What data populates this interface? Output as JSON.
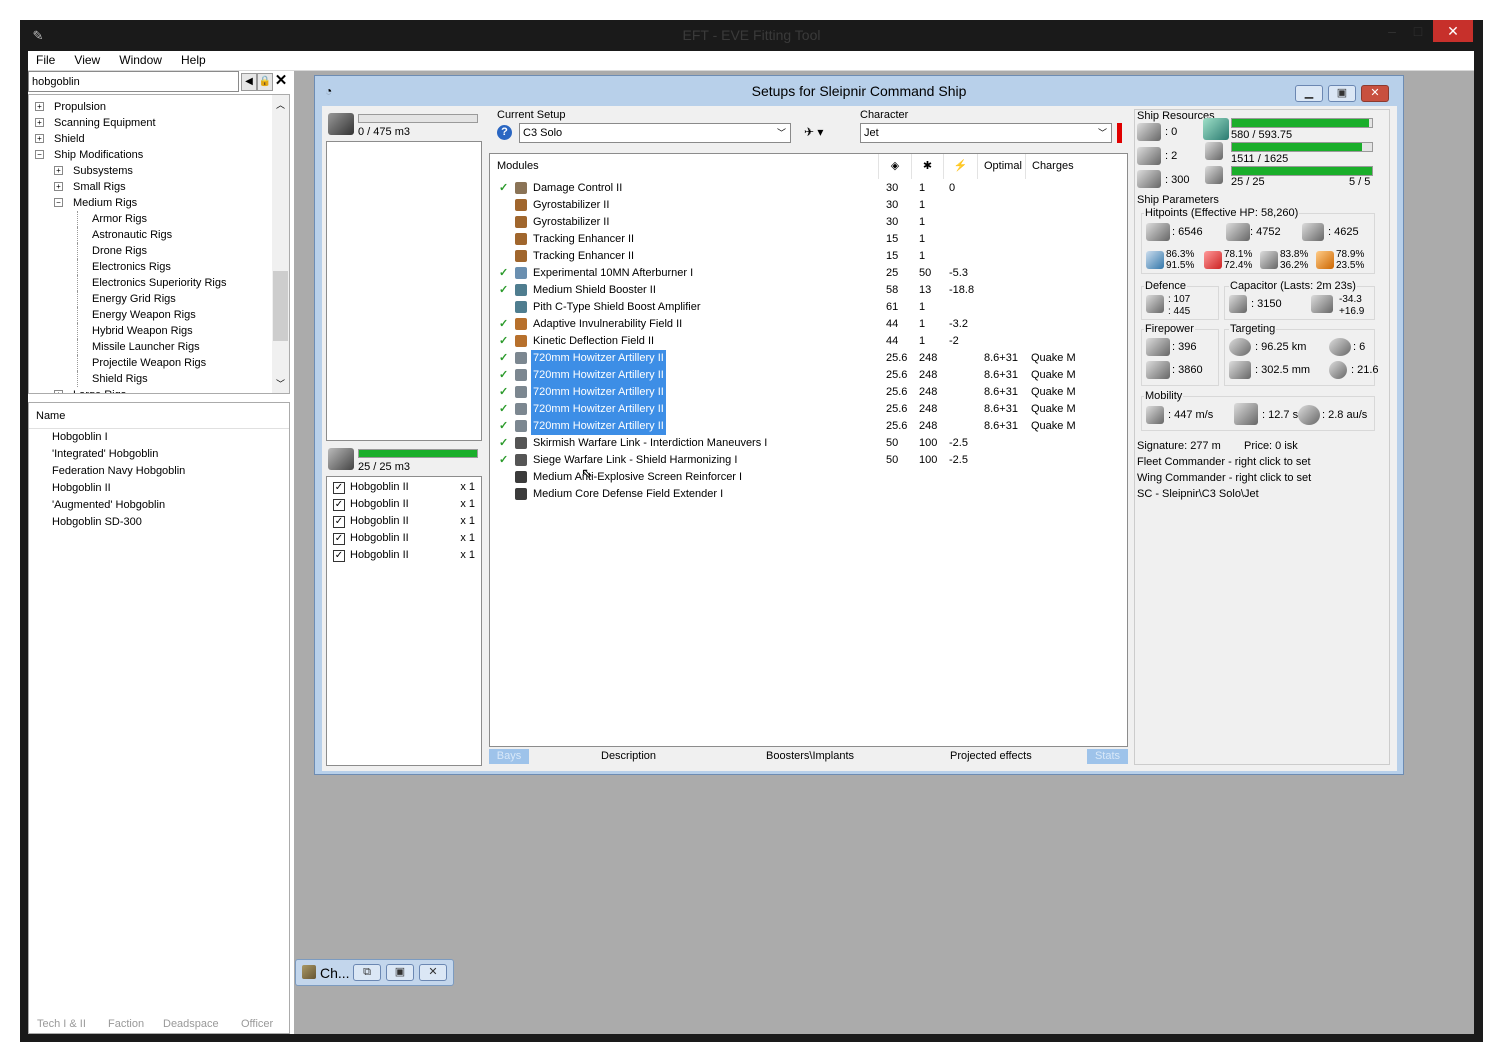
{
  "window": {
    "title": "EFT - EVE Fitting Tool",
    "app_icon": "eft-logo-icon"
  },
  "menu": [
    "File",
    "View",
    "Window",
    "Help"
  ],
  "search": {
    "value": "hobgoblin"
  },
  "tree": [
    {
      "label": "Propulsion",
      "indent": 0,
      "box": "+"
    },
    {
      "label": "Scanning Equipment",
      "indent": 0,
      "box": "+"
    },
    {
      "label": "Shield",
      "indent": 0,
      "box": "+"
    },
    {
      "label": "Ship Modifications",
      "indent": 0,
      "box": "−"
    },
    {
      "label": "Subsystems",
      "indent": 1,
      "box": "+"
    },
    {
      "label": "Small Rigs",
      "indent": 1,
      "box": "+"
    },
    {
      "label": "Medium Rigs",
      "indent": 1,
      "box": "−"
    },
    {
      "label": "Armor Rigs",
      "indent": 2
    },
    {
      "label": "Astronautic Rigs",
      "indent": 2
    },
    {
      "label": "Drone Rigs",
      "indent": 2
    },
    {
      "label": "Electronics Rigs",
      "indent": 2
    },
    {
      "label": "Electronics Superiority Rigs",
      "indent": 2
    },
    {
      "label": "Energy Grid Rigs",
      "indent": 2
    },
    {
      "label": "Energy Weapon Rigs",
      "indent": 2
    },
    {
      "label": "Hybrid Weapon Rigs",
      "indent": 2
    },
    {
      "label": "Missile Launcher Rigs",
      "indent": 2
    },
    {
      "label": "Projectile Weapon Rigs",
      "indent": 2
    },
    {
      "label": "Shield Rigs",
      "indent": 2
    },
    {
      "label": "Large Rigs",
      "indent": 1,
      "box": "+"
    }
  ],
  "names": {
    "header": "Name",
    "items": [
      "Hobgoblin I",
      "'Integrated' Hobgoblin",
      "Federation Navy Hobgoblin",
      "Hobgoblin II",
      "'Augmented' Hobgoblin",
      "Hobgoblin SD-300"
    ]
  },
  "bottom_tabs": [
    "Tech I & II",
    "Faction",
    "Deadspace",
    "Officer"
  ],
  "child_min": {
    "label": "Ch..."
  },
  "fit": {
    "title": "Setups for Sleipnir Command Ship",
    "cargo": {
      "text": "0 / 475 m3",
      "fill": 0
    },
    "drone_bay": {
      "text": "25 / 25 m3",
      "fill": 1.0
    },
    "drones": [
      {
        "name": "Hobgoblin II",
        "qty": "x 1"
      },
      {
        "name": "Hobgoblin II",
        "qty": "x 1"
      },
      {
        "name": "Hobgoblin II",
        "qty": "x 1"
      },
      {
        "name": "Hobgoblin II",
        "qty": "x 1"
      },
      {
        "name": "Hobgoblin II",
        "qty": "x 1"
      }
    ],
    "current_setup_label": "Current Setup",
    "current_setup": "C3 Solo",
    "character_label": "Character",
    "character": "Jet",
    "mod_headers": {
      "modules": "Modules",
      "optimal": "Optimal",
      "charges": "Charges"
    },
    "modules": [
      {
        "name": "Damage Control II",
        "on": true,
        "cpu": "30",
        "pg": "1",
        "cap": "0",
        "opt": "",
        "chg": "",
        "icon": "#8a7356"
      },
      {
        "name": "Gyrostabilizer II",
        "on": false,
        "cpu": "30",
        "pg": "1",
        "cap": "",
        "opt": "",
        "chg": "",
        "icon": "#a0662d"
      },
      {
        "name": "Gyrostabilizer II",
        "on": false,
        "cpu": "30",
        "pg": "1",
        "cap": "",
        "opt": "",
        "chg": "",
        "icon": "#a0662d"
      },
      {
        "name": "Tracking Enhancer II",
        "on": false,
        "cpu": "15",
        "pg": "1",
        "cap": "",
        "opt": "",
        "chg": "",
        "icon": "#a0662d"
      },
      {
        "name": "Tracking Enhancer II",
        "on": false,
        "cpu": "15",
        "pg": "1",
        "cap": "",
        "opt": "",
        "chg": "",
        "icon": "#a0662d"
      },
      {
        "name": "Experimental 10MN Afterburner I",
        "on": true,
        "cpu": "25",
        "pg": "50",
        "cap": "-5.3",
        "opt": "",
        "chg": "",
        "icon": "#6a8fb0"
      },
      {
        "name": "Medium Shield Booster II",
        "on": true,
        "cpu": "58",
        "pg": "13",
        "cap": "-18.8",
        "opt": "",
        "chg": "",
        "icon": "#4f7d8f"
      },
      {
        "name": "Pith C-Type Shield Boost Amplifier",
        "on": false,
        "cpu": "61",
        "pg": "1",
        "cap": "",
        "opt": "",
        "chg": "",
        "icon": "#4f7d8f"
      },
      {
        "name": "Adaptive Invulnerability Field II",
        "on": true,
        "cpu": "44",
        "pg": "1",
        "cap": "-3.2",
        "opt": "",
        "chg": "",
        "icon": "#b7702c"
      },
      {
        "name": "Kinetic Deflection Field II",
        "on": true,
        "cpu": "44",
        "pg": "1",
        "cap": "-2",
        "opt": "",
        "chg": "",
        "icon": "#b7702c"
      },
      {
        "name": "720mm Howitzer Artillery II",
        "on": true,
        "sel": true,
        "cpu": "25.6",
        "pg": "248",
        "cap": "",
        "opt": "8.6+31",
        "chg": "Quake M",
        "icon": "#7c8790"
      },
      {
        "name": "720mm Howitzer Artillery II",
        "on": true,
        "sel": true,
        "cpu": "25.6",
        "pg": "248",
        "cap": "",
        "opt": "8.6+31",
        "chg": "Quake M",
        "icon": "#7c8790"
      },
      {
        "name": "720mm Howitzer Artillery II",
        "on": true,
        "sel": true,
        "cpu": "25.6",
        "pg": "248",
        "cap": "",
        "opt": "8.6+31",
        "chg": "Quake M",
        "icon": "#7c8790"
      },
      {
        "name": "720mm Howitzer Artillery II",
        "on": true,
        "sel": true,
        "cpu": "25.6",
        "pg": "248",
        "cap": "",
        "opt": "8.6+31",
        "chg": "Quake M",
        "icon": "#7c8790"
      },
      {
        "name": "720mm Howitzer Artillery II",
        "on": true,
        "sel": true,
        "cpu": "25.6",
        "pg": "248",
        "cap": "",
        "opt": "8.6+31",
        "chg": "Quake M",
        "icon": "#7c8790"
      },
      {
        "name": "Skirmish Warfare Link - Interdiction Maneuvers I",
        "on": true,
        "cpu": "50",
        "pg": "100",
        "cap": "-2.5",
        "opt": "",
        "chg": "",
        "icon": "#555555"
      },
      {
        "name": "Siege Warfare Link - Shield Harmonizing I",
        "on": true,
        "cpu": "50",
        "pg": "100",
        "cap": "-2.5",
        "opt": "",
        "chg": "",
        "icon": "#555555"
      },
      {
        "name": "Medium Anti-Explosive Screen Reinforcer I",
        "on": false,
        "cpu": "",
        "pg": "",
        "cap": "",
        "opt": "",
        "chg": "",
        "icon": "#3b3b3b"
      },
      {
        "name": "Medium Core Defense Field Extender I",
        "on": false,
        "cpu": "",
        "pg": "",
        "cap": "",
        "opt": "",
        "chg": "",
        "icon": "#3b3b3b"
      }
    ],
    "tabs": [
      "Bays",
      "Description",
      "Boosters\\Implants",
      "Projected effects",
      "Stats"
    ],
    "stats": {
      "resources_label": "Ship Resources",
      "turrets": ": 0",
      "launchers": ": 2",
      "calibration": ": 300",
      "cpu": "580 / 593.75",
      "cpu_fill": 0.977,
      "pg": "1511 / 1625",
      "pg_fill": 0.93,
      "drone_bw": "25 / 25",
      "drone_count": "5 / 5",
      "drone_fill": 1.0,
      "params_label": "Ship Parameters",
      "hp_label": "Hitpoints (Effective HP: 58,260)",
      "shield_hp": ": 6546",
      "armor_hp": ": 4752",
      "hull_hp": ": 4625",
      "res_em": [
        "86.3%",
        "91.5%"
      ],
      "res_th": [
        "78.1%",
        "72.4%"
      ],
      "res_ki": [
        "83.8%",
        "36.2%"
      ],
      "res_ex": [
        "78.9%",
        "23.5%"
      ],
      "defence_label": "Defence",
      "def1": ": 107",
      "def2": ": 445",
      "cap_label": "Capacitor (Lasts: 2m 23s)",
      "cap_amt": ": 3150",
      "cap1": "-34.3",
      "cap2": "+16.9",
      "firepower_label": "Firepower",
      "fp1": ": 396",
      "fp2": ": 3860",
      "targeting_label": "Targeting",
      "range": ": 96.25 km",
      "targets": ": 6",
      "scan_res": ": 302.5 mm",
      "sensor": ": 21.6",
      "mobility_label": "Mobility",
      "speed": ": 447 m/s",
      "align": ": 12.7 s",
      "warp": ": 2.8 au/s",
      "signature": "Signature: 277 m",
      "price": "Price: 0 isk",
      "fleet": "Fleet Commander - right click to set",
      "wing": "Wing Commander - right click to set",
      "sc": "SC - Sleipnir\\C3 Solo\\Jet"
    }
  }
}
